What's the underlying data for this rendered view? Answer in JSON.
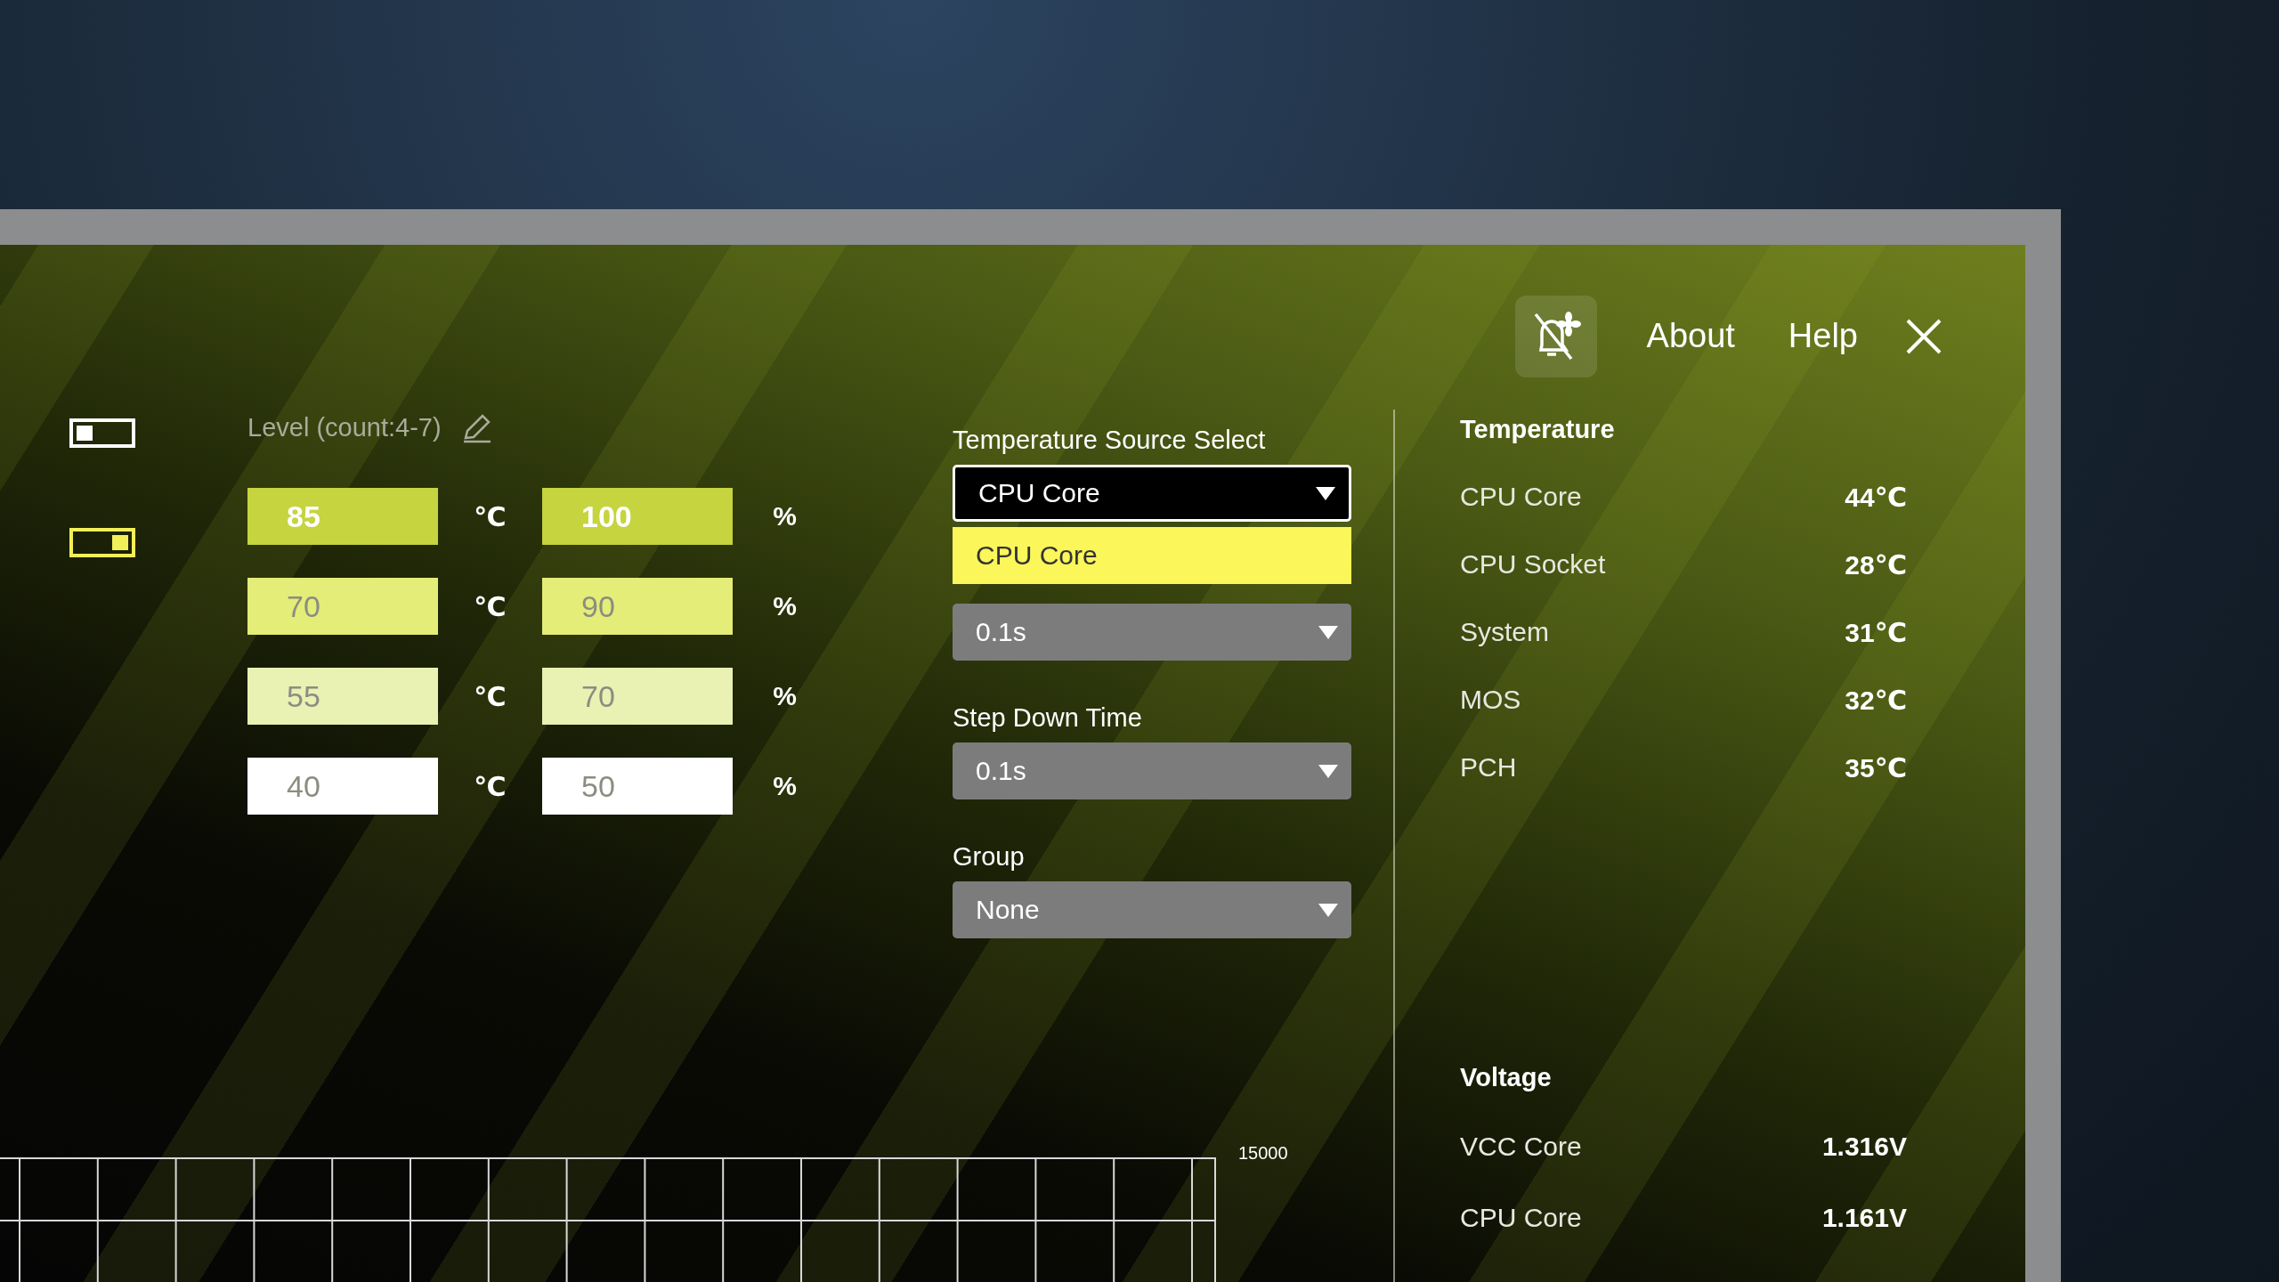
{
  "header": {
    "buttons": [
      {
        "label": "About"
      },
      {
        "label": "Help"
      }
    ]
  },
  "view_toggles": [
    {
      "selected": false
    },
    {
      "selected": true
    }
  ],
  "levels": {
    "label": "Level (count:4-7)",
    "rows": [
      {
        "temperature": "85",
        "temp_unit": "℃",
        "speed": "100",
        "speed_unit": "%",
        "selected": true,
        "color": "#c5d43f"
      },
      {
        "temperature": "70",
        "temp_unit": "℃",
        "speed": "90",
        "speed_unit": "%",
        "selected": false,
        "color": "#e3ed78"
      },
      {
        "temperature": "55",
        "temp_unit": "℃",
        "speed": "70",
        "speed_unit": "%",
        "selected": false,
        "color": "#e9f1b3"
      },
      {
        "temperature": "40",
        "temp_unit": "℃",
        "speed": "50",
        "speed_unit": "%",
        "selected": false,
        "color": "#ffffff"
      }
    ]
  },
  "selects": [
    {
      "label": "Temperature Source Select",
      "value": "CPU Core",
      "expanded": true,
      "options": [
        {
          "label": "CPU Core",
          "selected": true
        }
      ]
    },
    {
      "value": "0.1s",
      "expanded": false
    },
    {
      "label": "Step Down Time",
      "value": "0.1s",
      "expanded": false
    },
    {
      "label": "Group",
      "value": "None",
      "expanded": false
    }
  ],
  "chart": {
    "axis_label": "15000"
  },
  "temperature": {
    "title": "Temperature",
    "rows": [
      {
        "name": "CPU Core",
        "value": "44℃"
      },
      {
        "name": "CPU Socket",
        "value": "28℃"
      },
      {
        "name": "System",
        "value": "31℃"
      },
      {
        "name": "MOS",
        "value": "32℃"
      },
      {
        "name": "PCH",
        "value": "35℃"
      }
    ]
  },
  "voltage": {
    "title": "Voltage",
    "rows": [
      {
        "name": "VCC Core",
        "value": "1.316V"
      },
      {
        "name": "CPU Core",
        "value": "1.161V"
      }
    ]
  }
}
